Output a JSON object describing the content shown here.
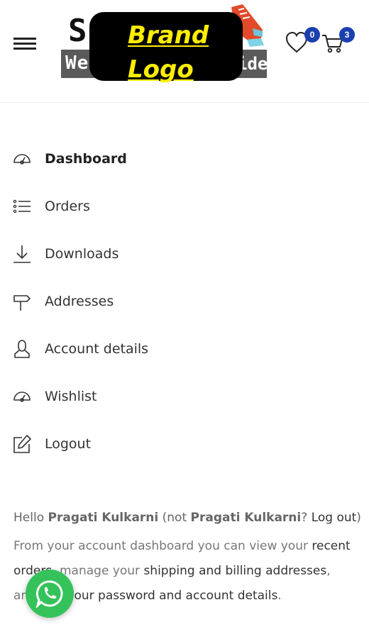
{
  "header": {
    "logo": {
      "overlay_line1": "Brand",
      "overlay_line2": "Logo",
      "left_letters": "S",
      "bottom_left": "We",
      "bottom_right": "ide"
    },
    "wishlist_count": "0",
    "cart_count": "3"
  },
  "nav": {
    "items": [
      {
        "label": "Dashboard",
        "icon": "dashboard-gauge-icon",
        "active": true
      },
      {
        "label": "Orders",
        "icon": "list-icon"
      },
      {
        "label": "Downloads",
        "icon": "download-icon"
      },
      {
        "label": "Addresses",
        "icon": "signpost-icon"
      },
      {
        "label": "Account details",
        "icon": "user-icon"
      },
      {
        "label": "Wishlist",
        "icon": "dashboard-gauge-icon"
      },
      {
        "label": "Logout",
        "icon": "edit-icon"
      }
    ]
  },
  "content": {
    "hello_prefix": "Hello ",
    "user_name": "Pragati Kulkarni",
    "not_prefix": " (not ",
    "not_name": "Pragati Kulkarni",
    "q_mark": "? ",
    "logout_link": "Log out",
    "close_paren": ")",
    "para_part1": "From your account dashboard you can view your ",
    "recent_orders_link": "recent orders",
    "para_part2": ", manage your ",
    "addresses_link": "shipping and billing addresses",
    "para_part3": ", and ",
    "account_link": "edit your password and account details",
    "para_part4": "."
  },
  "colors": {
    "badge": "#1b3fae",
    "whatsapp": "#35c25a",
    "logo_text": "#ffee00"
  }
}
